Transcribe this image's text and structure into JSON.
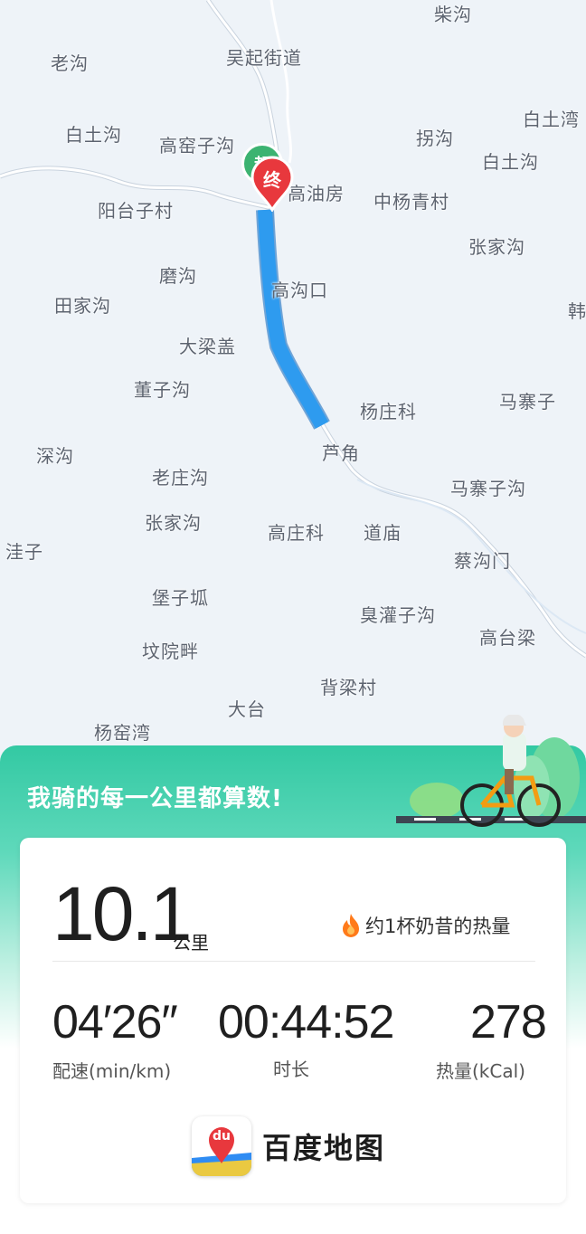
{
  "map": {
    "places": [
      {
        "id": "chaigou",
        "name": "柴沟"
      },
      {
        "id": "laogou",
        "name": "老沟"
      },
      {
        "id": "wuqijiedao",
        "name": "吴起街道"
      },
      {
        "id": "baitouwan",
        "name": "白土湾"
      },
      {
        "id": "baitugou1",
        "name": "白土沟"
      },
      {
        "id": "gaoyaozigou",
        "name": "高窑子沟"
      },
      {
        "id": "guaigou",
        "name": "拐沟"
      },
      {
        "id": "baitugou2",
        "name": "白土沟"
      },
      {
        "id": "gaoyoufang",
        "name": "高油房"
      },
      {
        "id": "zhongyangqingcun",
        "name": "中杨青村"
      },
      {
        "id": "yangtaizicun",
        "name": "阳台子村"
      },
      {
        "id": "zhangjiagou1",
        "name": "张家沟"
      },
      {
        "id": "mogou",
        "name": "磨沟"
      },
      {
        "id": "han",
        "name": "韩"
      },
      {
        "id": "tianjiagou",
        "name": "田家沟"
      },
      {
        "id": "gougoukou",
        "name": "高沟口"
      },
      {
        "id": "daliangai",
        "name": "大梁盖"
      },
      {
        "id": "dongzigou",
        "name": "董子沟"
      },
      {
        "id": "yangzhuangke",
        "name": "杨庄科"
      },
      {
        "id": "mazhaizi",
        "name": "马寨子"
      },
      {
        "id": "shengou",
        "name": "深沟"
      },
      {
        "id": "lujiao",
        "name": "芦角"
      },
      {
        "id": "laozhuanggou",
        "name": "老庄沟"
      },
      {
        "id": "mazhaizigou",
        "name": "马寨子沟"
      },
      {
        "id": "zhangjiagou2",
        "name": "张家沟"
      },
      {
        "id": "gaozhuangke",
        "name": "高庄科"
      },
      {
        "id": "daomiao",
        "name": "道庙"
      },
      {
        "id": "waizi",
        "name": "洼子"
      },
      {
        "id": "caigoumen",
        "name": "蔡沟门"
      },
      {
        "id": "baozipi",
        "name": "堡子坬"
      },
      {
        "id": "chouguanzigou",
        "name": "臭灌子沟"
      },
      {
        "id": "gaotailiang",
        "name": "高台梁"
      },
      {
        "id": "fenyuanpan",
        "name": "坟院畔"
      },
      {
        "id": "beiliangcun",
        "name": "背梁村"
      },
      {
        "id": "datai",
        "name": "大台"
      },
      {
        "id": "yangyaowan",
        "name": "杨窑湾"
      }
    ],
    "end_marker": "终",
    "start_marker": "起",
    "route_color": "#2e9bef"
  },
  "panel": {
    "slogan": "我骑的每一公里都算数!",
    "distance": {
      "value": "10.1",
      "unit": "公里"
    },
    "calorie_note": "约1杯奶昔的热量",
    "stats": [
      {
        "id": "pace",
        "value": "04′26″",
        "label": "配速(min/km)"
      },
      {
        "id": "duration",
        "value": "00:44:52",
        "label": "时长"
      },
      {
        "id": "calories",
        "value": "278",
        "label": "热量(kCal)"
      }
    ],
    "brand": {
      "logo_text": "du",
      "name": "百度地图"
    }
  },
  "colors": {
    "accent": "#33c9a3",
    "route": "#2e9bef",
    "end_marker": "#e8383d",
    "start_marker": "#3cb371"
  }
}
